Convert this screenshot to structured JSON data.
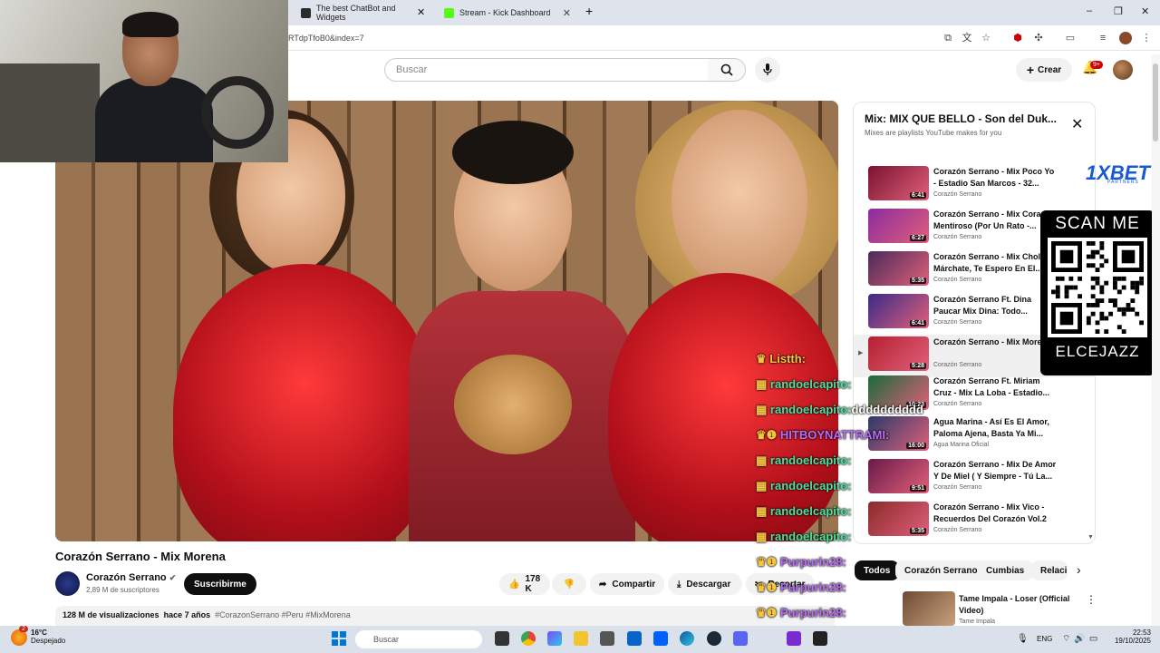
{
  "browser": {
    "tabs": [
      {
        "label": "The best ChatBot and Widgets",
        "favicon_color": "#2b2b2b"
      },
      {
        "label": "Stream - Kick Dashboard",
        "favicon_color": "#53fc18"
      }
    ],
    "new_tab": "+",
    "url": "RTdpTfoB0&index=7",
    "window_controls": [
      "–",
      "❐",
      "✕"
    ]
  },
  "youtube": {
    "search_placeholder": "Buscar",
    "create_label": "Crear",
    "notifications_badge": "9+"
  },
  "video": {
    "title": "Corazón Serrano - Mix Morena",
    "channel": "Corazón Serrano",
    "subscribers": "2,89 M de suscriptores",
    "subscribe_label": "Suscribirme",
    "likes": "178 K",
    "share_label": "Compartir",
    "download_label": "Descargar",
    "clip_label": "Recortar",
    "views": "128 M de visualizaciones",
    "age": "hace 7 años",
    "hashtags": "#CorazonSerrano #Peru #MixMorena"
  },
  "mix": {
    "title": "Mix: MIX QUE BELLO - Son del Duk...",
    "subtitle": "Mixes are playlists YouTube makes for you",
    "items": [
      {
        "title": "Corazón Serrano - Mix Poco Yo - Estadio San Marcos - 32...",
        "channel": "Corazón Serrano",
        "duration": "6:41",
        "color": "#7a1230"
      },
      {
        "title": "Corazón Serrano - Mix Corazón Mentiroso (Por Un Rato -...",
        "channel": "Corazón Serrano",
        "duration": "6:27",
        "color": "#8a2aa0"
      },
      {
        "title": "Corazón Serrano - Mix Cholita Márchate, Te Espero En El...",
        "channel": "Corazón Serrano",
        "duration": "5:35",
        "color": "#4a2a5a"
      },
      {
        "title": "Corazón Serrano Ft. Dina Paucar Mix Dina: Todo...",
        "channel": "Corazón Serrano",
        "duration": "6:41",
        "color": "#3a2a8a"
      },
      {
        "title": "Corazón Serrano - Mix Morena",
        "channel": "Corazón Serrano",
        "duration": "5:28",
        "color": "#b52030"
      },
      {
        "title": "Corazón Serrano Ft. Miriam Cruz - Mix La Loba - Estadio...",
        "channel": "Corazón Serrano",
        "duration": "10:23",
        "color": "#1a6a3a"
      },
      {
        "title": "Agua Marina - Así Es El Amor, Paloma Ajena, Basta Ya Mi...",
        "channel": "Agua Marina Oficial",
        "duration": "16:00",
        "color": "#2a3a6a"
      },
      {
        "title": "Corazón Serrano - Mix De Amor Y De Miel ( Y Siempre - Tú La...",
        "channel": "Corazón Serrano",
        "duration": "9:51",
        "color": "#6a1a4a"
      },
      {
        "title": "Corazón Serrano - Mix Vico - Recuerdos Del Corazón Vol.2",
        "channel": "Corazón Serrano",
        "duration": "5:35",
        "color": "#8a2a2a"
      }
    ]
  },
  "chips": [
    "Todos",
    "Corazón Serrano",
    "Cumbias",
    "Relaci"
  ],
  "recommendation": {
    "title": "Tame Impala - Loser (Official Video)",
    "channel": "Tame Impala"
  },
  "sponsor": {
    "brand": "1XBET",
    "tagline": "PARTNERS",
    "scan": "SCAN ME",
    "qr_brand": "1XBET",
    "code": "ELCEJAZZ"
  },
  "chat": [
    {
      "user": "Listth:",
      "text": "",
      "style": "yellow"
    },
    {
      "user": "randoelcapito:",
      "text": "",
      "style": "green"
    },
    {
      "user": "randoelcapito:",
      "text": "dddddddddd",
      "style": "green"
    },
    {
      "user": "HITBOYNATTRAMI:",
      "text": "",
      "style": "purple"
    },
    {
      "user": "randoelcapito:",
      "text": "",
      "style": "green"
    },
    {
      "user": "randoelcapito:",
      "text": "",
      "style": "green"
    },
    {
      "user": "randoelcapito:",
      "text": "",
      "style": "green"
    },
    {
      "user": "randoelcapito:",
      "text": "",
      "style": "green"
    },
    {
      "user": "Purpurin28:",
      "text": "",
      "style": "purple"
    },
    {
      "user": "Purpurin28:",
      "text": "",
      "style": "purple"
    },
    {
      "user": "Purpurin28:",
      "text": "",
      "style": "purple"
    },
    {
      "user": "Purpurin28:",
      "text": "",
      "style": "purple"
    }
  ],
  "taskbar": {
    "temp": "16°C",
    "weather": "Despejado",
    "search_placeholder": "Buscar",
    "lang": "ENG",
    "time": "22:53",
    "date": "19/10/2025",
    "notif_count": "2"
  }
}
